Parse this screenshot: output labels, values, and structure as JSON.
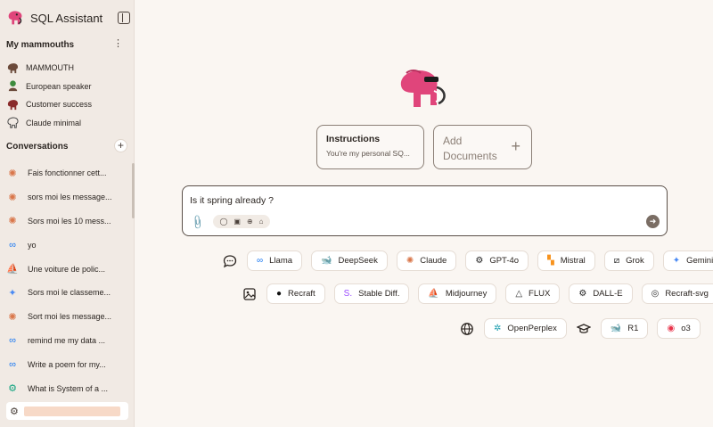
{
  "app": {
    "title": "SQL Assistant"
  },
  "mammouths": {
    "title": "My mammouths",
    "items": [
      {
        "label": "MAMMOUTH",
        "icon": "mammoth-avatar-icon"
      },
      {
        "label": "European speaker",
        "icon": "european-avatar-icon"
      },
      {
        "label": "Customer success",
        "icon": "support-avatar-icon"
      },
      {
        "label": "Claude minimal",
        "icon": "minimal-avatar-icon"
      }
    ]
  },
  "conversations": {
    "title": "Conversations",
    "add_label": "+",
    "items": [
      {
        "label": "Fais fonctionner cett...",
        "icon": "claude-icon",
        "glyph": "✺",
        "color": "#d9774b"
      },
      {
        "label": "sors moi les message...",
        "icon": "claude-icon",
        "glyph": "✺",
        "color": "#d9774b"
      },
      {
        "label": "Sors moi les 10 mess...",
        "icon": "claude-icon",
        "glyph": "✺",
        "color": "#d9774b"
      },
      {
        "label": "yo",
        "icon": "meta-icon",
        "glyph": "∞",
        "color": "#1877f2"
      },
      {
        "label": "Une voiture de polic...",
        "icon": "midjourney-icon",
        "glyph": "⛵",
        "color": "#555555"
      },
      {
        "label": "Sors moi le classeme...",
        "icon": "gemini-icon",
        "glyph": "✦",
        "color": "#4a8af4"
      },
      {
        "label": "Sort moi les message...",
        "icon": "claude-icon",
        "glyph": "✺",
        "color": "#d9774b"
      },
      {
        "label": "remind me my data ...",
        "icon": "meta-icon",
        "glyph": "∞",
        "color": "#1877f2"
      },
      {
        "label": "Write a poem for my...",
        "icon": "meta-icon",
        "glyph": "∞",
        "color": "#1877f2"
      },
      {
        "label": "What is System of a ...",
        "icon": "openai-icon",
        "glyph": "⚙",
        "color": "#10a37f"
      }
    ]
  },
  "instructions": {
    "title": "Instructions",
    "subtitle": "You're my personal SQ..."
  },
  "documents": {
    "label": "Add Documents",
    "plus": "+"
  },
  "composer": {
    "text": "Is it spring already ?"
  },
  "model_rows": [
    {
      "icon": "chat-bubble-icon",
      "models": [
        {
          "label": "Llama",
          "icon": "meta-icon",
          "glyph": "∞",
          "color": "#1877f2"
        },
        {
          "label": "DeepSeek",
          "icon": "deepseek-icon",
          "glyph": "🐋",
          "color": "#4d6bfe"
        },
        {
          "label": "Claude",
          "icon": "claude-icon",
          "glyph": "✺",
          "color": "#d9774b"
        },
        {
          "label": "GPT-4o",
          "icon": "openai-icon",
          "glyph": "⚙",
          "color": "#222222"
        },
        {
          "label": "Mistral",
          "icon": "mistral-icon",
          "glyph": "▚",
          "color": "#f7931e"
        },
        {
          "label": "Grok",
          "icon": "grok-icon",
          "glyph": "⧄",
          "color": "#111111"
        },
        {
          "label": "Gemini",
          "icon": "gemini-icon",
          "glyph": "✦",
          "color": "#4a8af4"
        }
      ]
    },
    {
      "icon": "image-icon",
      "models": [
        {
          "label": "Recraft",
          "icon": "recraft-icon",
          "glyph": "●",
          "color": "#111111"
        },
        {
          "label": "Stable Diff.",
          "icon": "stability-icon",
          "glyph": "S.",
          "color": "#9b4dff"
        },
        {
          "label": "Midjourney",
          "icon": "midjourney-icon",
          "glyph": "⛵",
          "color": "#555555"
        },
        {
          "label": "FLUX",
          "icon": "flux-icon",
          "glyph": "△",
          "color": "#333333"
        },
        {
          "label": "DALL-E",
          "icon": "openai-icon",
          "glyph": "⚙",
          "color": "#222222"
        },
        {
          "label": "Recraft-svg",
          "icon": "recraft-svg-icon",
          "glyph": "◎",
          "color": "#333333"
        }
      ]
    },
    {
      "icon": "globe-icon",
      "models": [
        {
          "label": "OpenPerplex",
          "icon": "openperplex-icon",
          "glyph": "✲",
          "color": "#20a0b0"
        }
      ]
    },
    {
      "icon": "graduation-cap-icon",
      "models": [
        {
          "label": "R1",
          "icon": "deepseek-icon",
          "glyph": "🐋",
          "color": "#4d6bfe"
        },
        {
          "label": "o3",
          "icon": "o3-icon",
          "glyph": "◉",
          "color": "#e8334a"
        }
      ]
    }
  ]
}
